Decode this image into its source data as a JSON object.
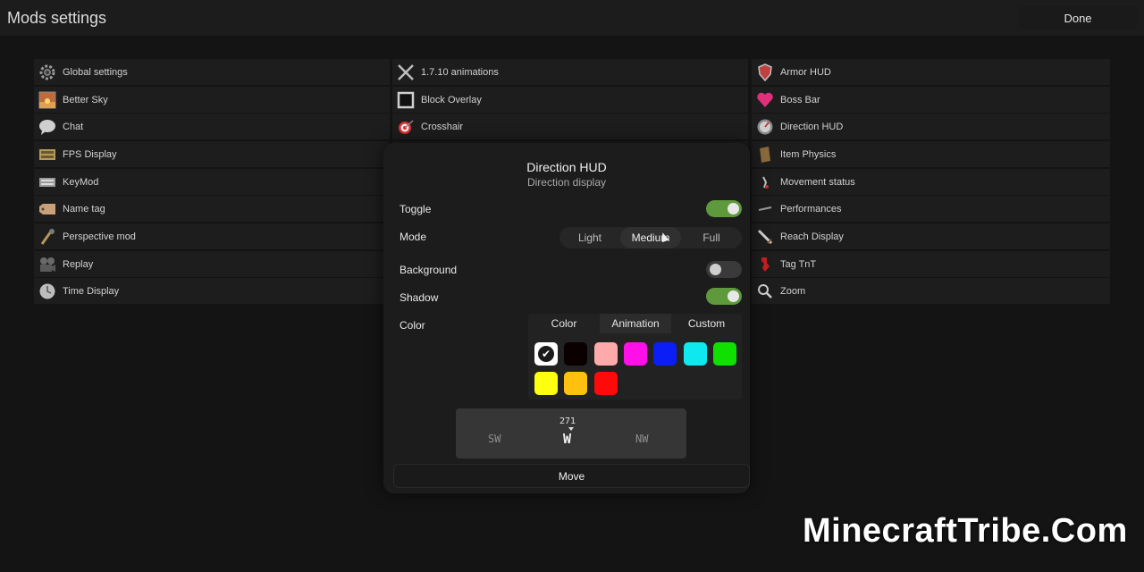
{
  "header": {
    "title": "Mods settings",
    "done_label": "Done"
  },
  "mods": {
    "col1": [
      {
        "label": "Global settings",
        "icon": "gear-icon"
      },
      {
        "label": "Better Sky",
        "icon": "sky-icon"
      },
      {
        "label": "Chat",
        "icon": "chat-bubble-icon"
      },
      {
        "label": "FPS Display",
        "icon": "fps-icon"
      },
      {
        "label": "KeyMod",
        "icon": "keyboard-icon"
      },
      {
        "label": "Name tag",
        "icon": "name-tag-icon"
      },
      {
        "label": "Perspective mod",
        "icon": "perspective-icon"
      },
      {
        "label": "Replay",
        "icon": "camera-icon"
      },
      {
        "label": "Time Display",
        "icon": "clock-icon"
      }
    ],
    "col2": [
      {
        "label": "1.7.10 animations",
        "icon": "crossed-swords-icon"
      },
      {
        "label": "Block Overlay",
        "icon": "block-outline-icon"
      },
      {
        "label": "Crosshair",
        "icon": "target-icon"
      }
    ],
    "col3": [
      {
        "label": "Armor HUD",
        "icon": "shield-icon"
      },
      {
        "label": "Boss Bar",
        "icon": "heart-icon"
      },
      {
        "label": "Direction HUD",
        "icon": "compass-icon"
      },
      {
        "label": "Item Physics",
        "icon": "item-icon"
      },
      {
        "label": "Movement status",
        "icon": "movement-icon"
      },
      {
        "label": "Performances",
        "icon": "performance-icon"
      },
      {
        "label": "Reach Display",
        "icon": "sword-icon"
      },
      {
        "label": "Tag TnT",
        "icon": "tnt-icon"
      },
      {
        "label": "Zoom",
        "icon": "magnifier-icon"
      }
    ]
  },
  "modal": {
    "title": "Direction HUD",
    "subtitle": "Direction display",
    "toggle_label": "Toggle",
    "toggle_on": true,
    "mode_label": "Mode",
    "mode_options": [
      "Light",
      "Medium",
      "Full"
    ],
    "mode_selected": "Medium",
    "background_label": "Background",
    "background_on": false,
    "shadow_label": "Shadow",
    "shadow_on": true,
    "color_label": "Color",
    "color_tabs": [
      "Color",
      "Animation",
      "Custom"
    ],
    "color_tab_selected": "Color",
    "swatches": [
      "#ffffff",
      "#0a0000",
      "#ffaaaa",
      "#ff10e8",
      "#0b1ef5",
      "#10e8f0",
      "#10e000",
      "#ffff10",
      "#ffc010",
      "#ff0a0a"
    ],
    "selected_swatch": "#ffffff",
    "preview": {
      "heading": "271",
      "left": "SW",
      "center": "W",
      "right": "NW"
    },
    "move_label": "Move"
  },
  "watermark": "MinecraftTribe.Com",
  "colors": {
    "accent_on": "#5e9a3c",
    "panel": "#1c1c1c",
    "row": "#1d1d1d"
  }
}
